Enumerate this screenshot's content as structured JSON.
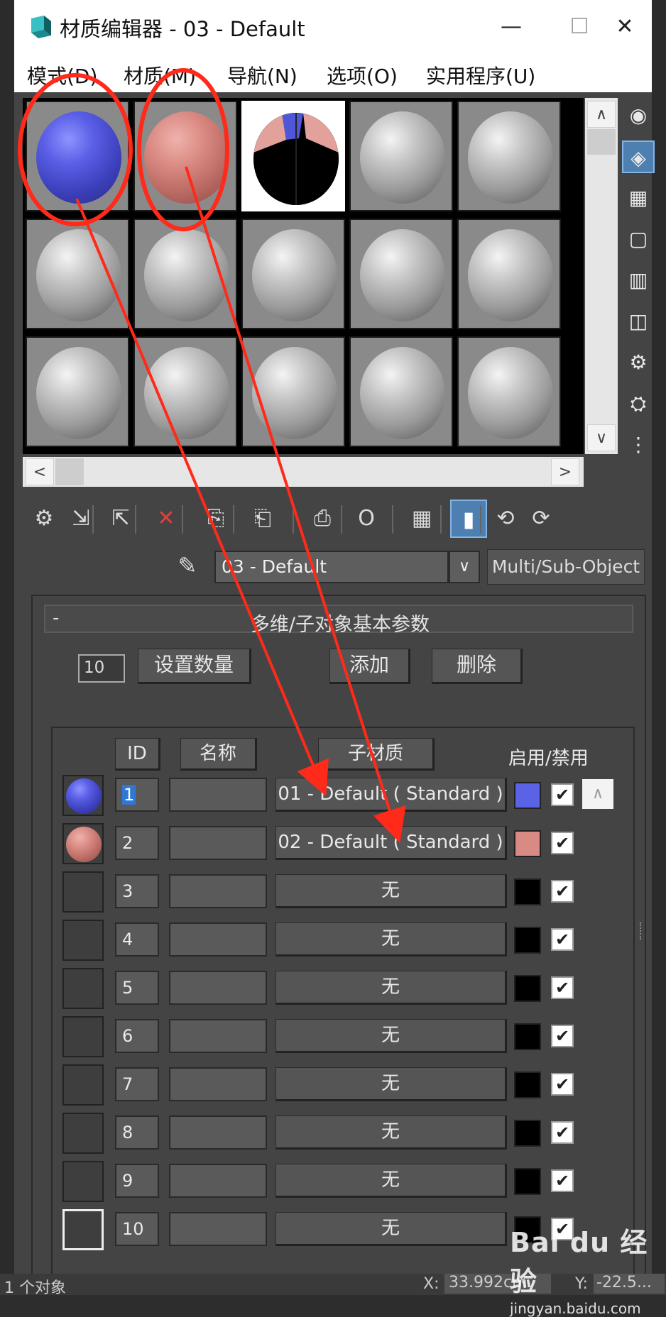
{
  "window": {
    "title": "材质编辑器 - 03 - Default",
    "min_glyph": "—",
    "max_glyph": "☐",
    "close_glyph": "✕",
    "logo_icon": "3dsmax-logo-icon"
  },
  "menu": [
    "模式(D)",
    "材质(M)",
    "导航(N)",
    "选项(O)",
    "实用程序(U)"
  ],
  "sample_slots": {
    "rows": 3,
    "cols": 5,
    "slot_types": [
      [
        "blue",
        "pink",
        "multi",
        "grey",
        "grey"
      ],
      [
        "grey",
        "grey",
        "grey",
        "grey",
        "grey"
      ],
      [
        "grey",
        "grey",
        "grey",
        "grey",
        "grey"
      ]
    ],
    "selected": [
      0,
      2
    ],
    "colors": {
      "blue": "#5a5fe6",
      "pink": "#d88880",
      "multi_pink": "#e2a19a"
    }
  },
  "scroll": {
    "up": "∧",
    "down": "∨",
    "left": "<",
    "right": ">"
  },
  "side_tools": [
    "sample-type-sphere-icon",
    "backlight-icon",
    "background-checker-icon",
    "uv-tiling-icon",
    "video-color-check-icon",
    "make-preview-icon",
    "options-icon",
    "select-by-material-icon",
    "material-map-navigator-icon"
  ],
  "toolbar": [
    "get-material-icon",
    "put-to-scene-icon",
    "assign-to-selection-icon",
    "reset-map-icon",
    "make-copy-icon",
    "make-unique-icon",
    "put-to-library-icon",
    "material-id-channel-icon",
    "show-map-in-viewport-icon",
    "show-end-result-icon",
    "go-to-parent-icon",
    "go-forward-to-sibling-icon"
  ],
  "toolbar_glyphs": [
    "⚙",
    "⇲",
    "⇱",
    "✕",
    "⎘",
    "⎗",
    "⎙",
    "O",
    "▦",
    "▮",
    "⟲",
    "⟳"
  ],
  "material": {
    "dropper_glyph": "✎",
    "name": "03 - Default",
    "dropdown_glyph": "∨",
    "type": "Multi/Sub-Object"
  },
  "rollout": {
    "collapse": "-",
    "title": "多维/子对象基本参数",
    "count": "10",
    "set_count": "设置数量",
    "add": "添加",
    "delete": "删除"
  },
  "list": {
    "headers": {
      "id": "ID",
      "name": "名称",
      "sub": "子材质",
      "enable": "启用/禁用"
    },
    "check_glyph": "✔",
    "scroll_up": "∧",
    "rows": [
      {
        "id": "1",
        "sub": "01 - Default ( Standard )",
        "swatch": "#5a62e6",
        "preview": "blue"
      },
      {
        "id": "2",
        "sub": "02 - Default ( Standard )",
        "swatch": "#d98a84",
        "preview": "pink"
      },
      {
        "id": "3",
        "sub": "无",
        "swatch": "#000000",
        "preview": "none"
      },
      {
        "id": "4",
        "sub": "无",
        "swatch": "#000000",
        "preview": "none"
      },
      {
        "id": "5",
        "sub": "无",
        "swatch": "#000000",
        "preview": "none"
      },
      {
        "id": "6",
        "sub": "无",
        "swatch": "#000000",
        "preview": "none"
      },
      {
        "id": "7",
        "sub": "无",
        "swatch": "#000000",
        "preview": "none"
      },
      {
        "id": "8",
        "sub": "无",
        "swatch": "#000000",
        "preview": "none"
      },
      {
        "id": "9",
        "sub": "无",
        "swatch": "#000000",
        "preview": "none"
      },
      {
        "id": "10",
        "sub": "无",
        "swatch": "#000000",
        "preview": "none"
      }
    ]
  },
  "status_bar": {
    "text": "1 个对象",
    "x_label": "X:",
    "x_value": "33.992cm",
    "y_label": "Y:",
    "y_value": "-22.5..."
  },
  "watermark": {
    "brand": "Bai du 经验",
    "url": "jingyan.baidu.com"
  },
  "annotation_color": "#ff2a1a"
}
